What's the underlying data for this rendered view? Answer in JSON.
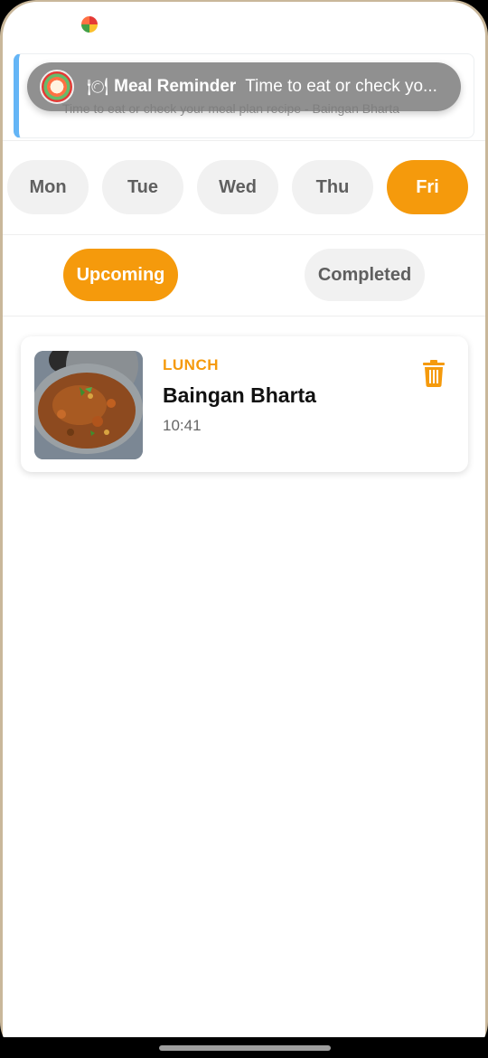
{
  "notification": {
    "icon": "plate-icon",
    "title": "Meal Reminder",
    "text": "Time to eat or check yo..."
  },
  "reminder_card": {
    "subtitle": "Time to eat or check your meal plan recipe - Baingan Bharta"
  },
  "days": [
    "Mon",
    "Tue",
    "Wed",
    "Thu",
    "Fri"
  ],
  "selected_day": "Fri",
  "tabs": {
    "upcoming": "Upcoming",
    "completed": "Completed",
    "selected": "Upcoming"
  },
  "meal": {
    "type": "LUNCH",
    "name": "Baingan Bharta",
    "time": "10:41",
    "image": "baingan-bharta-dish"
  },
  "colors": {
    "accent": "#f59a0c",
    "inactive_bg": "#f1f1f1",
    "inactive_text": "#5f5f5f",
    "reminder_border": "#64b5f6"
  }
}
